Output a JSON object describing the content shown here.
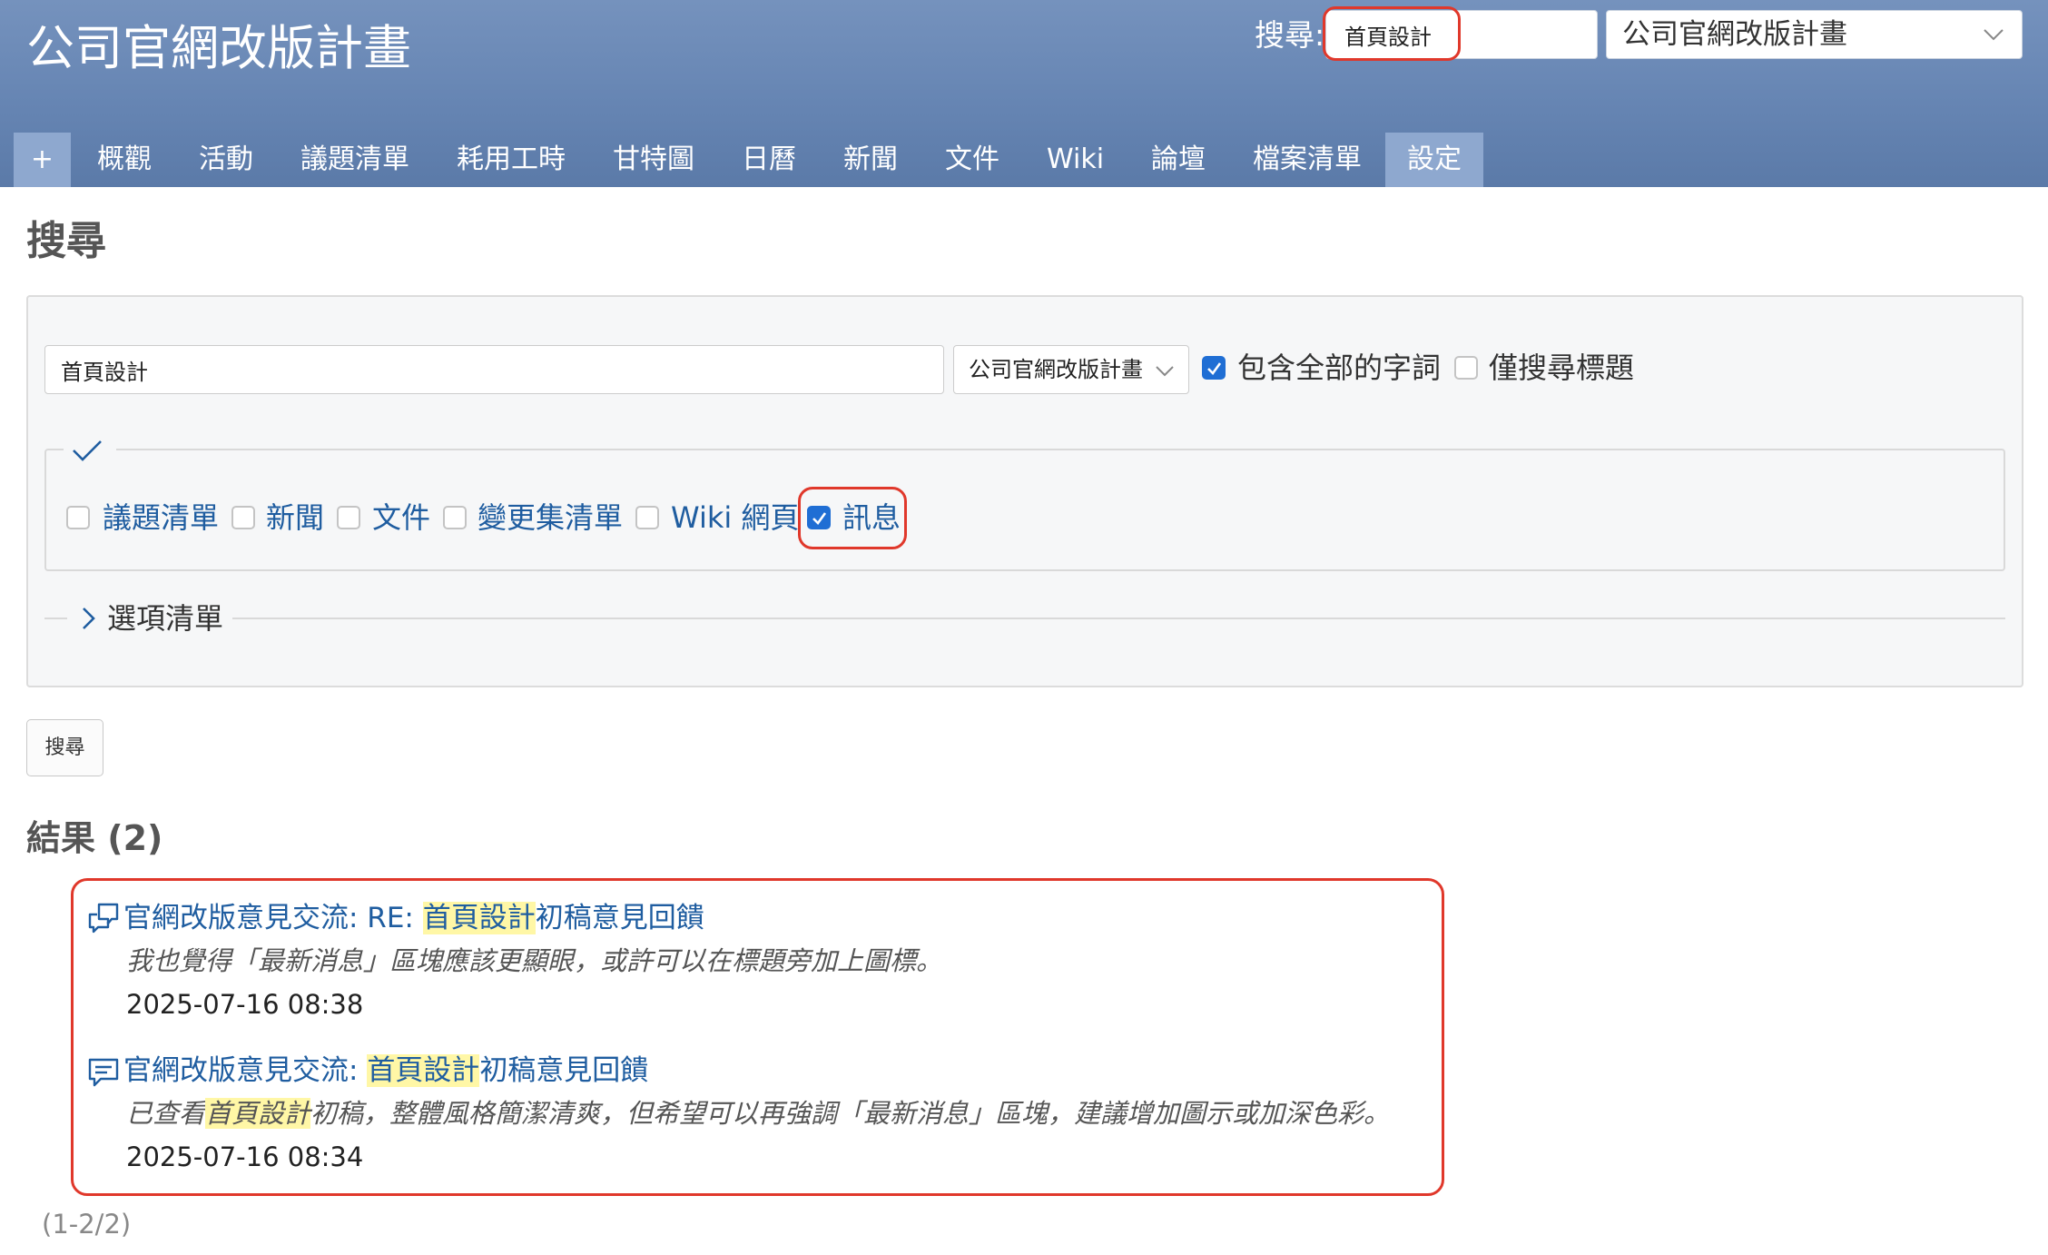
{
  "header": {
    "project_title": "公司官網改版計畫",
    "quick_search_label": "搜尋:",
    "quick_search_value": "首頁設計",
    "project_jump_value": "公司官網改版計畫"
  },
  "menu": {
    "plus": "+",
    "tabs": [
      "概觀",
      "活動",
      "議題清單",
      "耗用工時",
      "甘特圖",
      "日曆",
      "新聞",
      "文件",
      "Wiki",
      "論壇",
      "檔案清單",
      "設定"
    ],
    "selected_index": 11
  },
  "page_title": "搜尋",
  "search_form": {
    "query": "首頁設計",
    "scope": "公司官網改版計畫",
    "all_words_label": "包含全部的字詞",
    "all_words_checked": true,
    "titles_only_label": "僅搜尋標題",
    "titles_only_checked": false,
    "types": [
      {
        "label": "議題清單",
        "checked": false
      },
      {
        "label": "新聞",
        "checked": false
      },
      {
        "label": "文件",
        "checked": false
      },
      {
        "label": "變更集清單",
        "checked": false
      },
      {
        "label": "Wiki 網頁",
        "checked": false
      },
      {
        "label": "訊息",
        "checked": true
      }
    ],
    "options_label": "選項清單",
    "submit_label": "搜尋"
  },
  "results": {
    "title": "結果 (2)",
    "items": [
      {
        "icon": "reply-message-icon",
        "title_prefix": "官網改版意見交流: RE: ",
        "title_highlight": "首頁設計",
        "title_suffix": "初稿意見回饋",
        "description": "我也覺得「最新消息」區塊應該更顯眼，或許可以在標題旁加上圖標。",
        "datetime": "2025-07-16 08:38"
      },
      {
        "icon": "message-icon",
        "title_prefix": "官網改版意見交流: ",
        "title_highlight": "首頁設計",
        "title_suffix": "初稿意見回饋",
        "description_prefix": "已查看",
        "description_highlight": "首頁設計",
        "description_suffix": "初稿，整體風格簡潔清爽，但希望可以再強調「最新消息」區塊，建議增加圖示或加深色彩。",
        "datetime": "2025-07-16 08:34"
      }
    ],
    "pagination": "(1-2/2)"
  },
  "colors": {
    "header": "#6685b3",
    "selected_tab": "#8ea8cf",
    "link": "#1f5da0",
    "checkbox_checked": "#1f6ed4",
    "annotation_red": "#e0382b",
    "highlight": "#fff7a6"
  }
}
